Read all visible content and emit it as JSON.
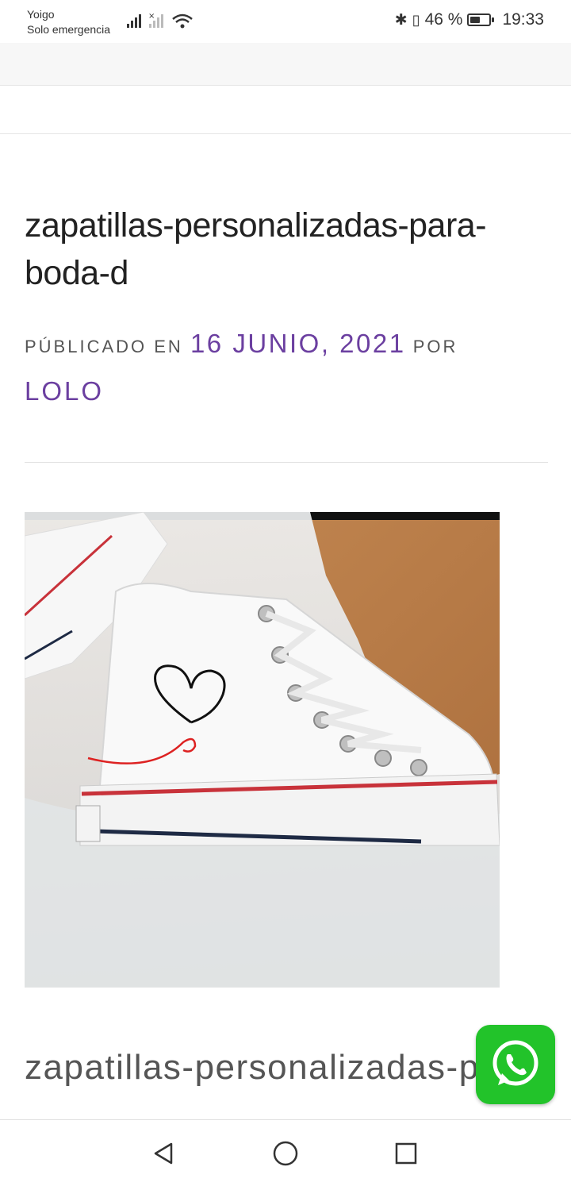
{
  "status_bar": {
    "carrier": "Yoigo",
    "carrier_status": "Solo emergencia",
    "battery_percent": "46 %",
    "battery_level": 0.46,
    "time": "19:33",
    "icons": [
      "signal-icon",
      "no-signal-icon",
      "wifi-icon",
      "bluetooth-icon",
      "vibrate-icon",
      "battery-icon"
    ]
  },
  "post": {
    "title": "zapatillas-personalizadas-para-boda-d",
    "meta": {
      "published_label": "PÚBLICADO EN",
      "date": "16 JUNIO, 2021",
      "by_label": "POR",
      "author": "LOLO"
    },
    "image_subject": "white high-top sneaker with hand-painted heart",
    "caption": "zapatillas-personalizadas-para-boda-d"
  },
  "floating": {
    "whatsapp_icon": "whatsapp-icon",
    "whatsapp_color": "#22c32a"
  },
  "nav": {
    "items": [
      "back-icon",
      "home-icon",
      "recents-icon"
    ]
  },
  "colors": {
    "accent": "#6b3fa0",
    "meta_text": "#555555"
  }
}
